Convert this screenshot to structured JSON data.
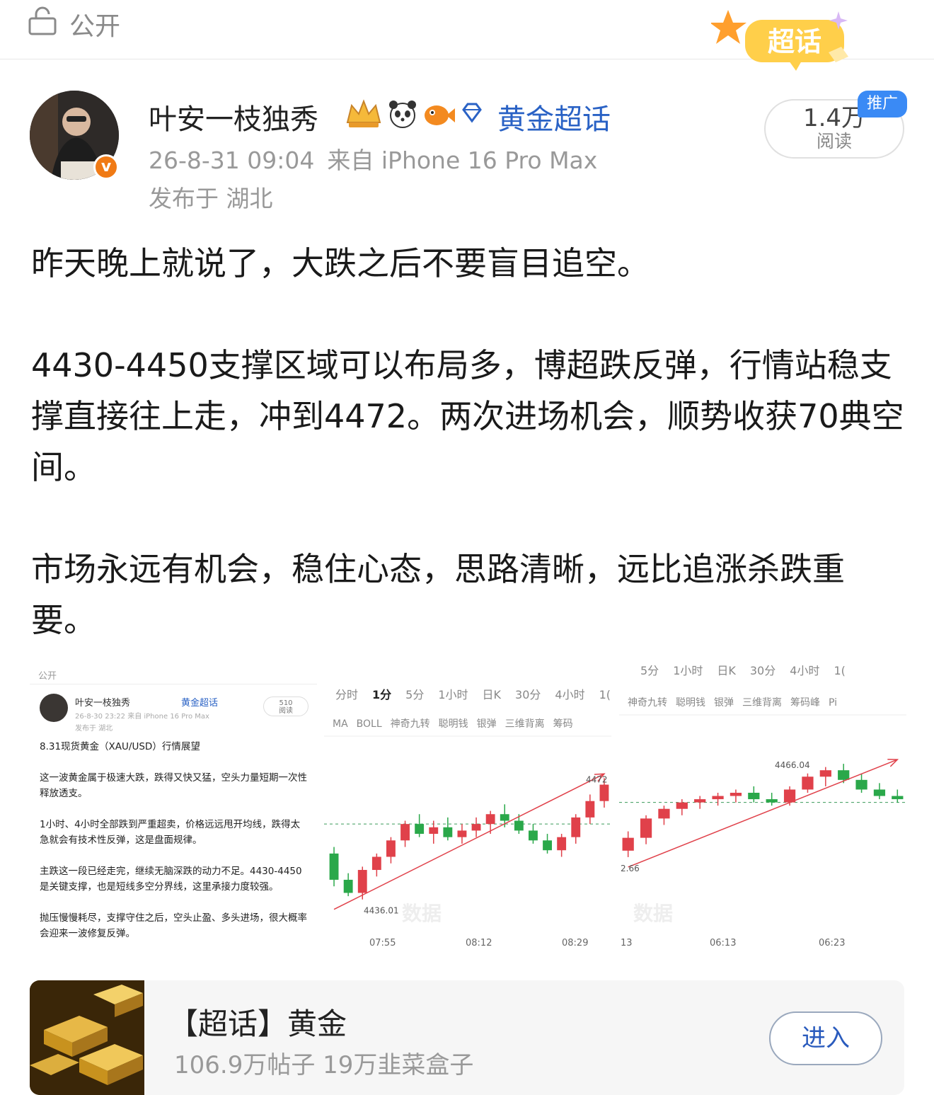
{
  "header": {
    "visibility_label": "公开",
    "supertopic_badge": "超话"
  },
  "author": {
    "name": "叶安一枝独秀",
    "topic_link": "黄金超话",
    "time": "26-8-31 09:04",
    "source": "来自 iPhone 16 Pro Max",
    "location": "发布于 湖北"
  },
  "read": {
    "count": "1.4万",
    "label": "阅读",
    "promo": "推广"
  },
  "post": {
    "p1": "昨天晚上就说了，大跌之后不要盲目追空。",
    "p2": "4430-4450支撑区域可以布局多，博超跌反弹，行情站稳支撑直接往上走，冲到4472。两次进场机会，顺势收获70典空间。",
    "p3": "市场永远有机会，稳住心态，思路清晰，远比追涨杀跌重要。"
  },
  "image1": {
    "visibility": "公开",
    "name": "叶安一枝独秀",
    "topic": "黄金超话",
    "meta": "26-8-30 23:22  来自 iPhone 16 Pro Max",
    "location": "发布于 湖北",
    "read_count": "510",
    "read_label": "阅读",
    "title": "8.31现货黄金（XAU/USD）行情展望",
    "para1": "这一波黄金属于极速大跌，跌得又快又猛，空头力量短期一次性释放透支。",
    "para2": "1小时、4小时全部跌到严重超卖，价格远远甩开均线，跌得太急就会有技术性反弹，这是盘面规律。",
    "para3": "主跌这一段已经走完，继续无脑深跌的动力不足。4430-4450是关键支撑，也是短线多空分界线，这里承接力度较强。",
    "para4": "抛压慢慢耗尽，支撑守住之后，空头止盈、多头进场，很大概率会迎来一波修复反弹。"
  },
  "chart1": {
    "tabs": [
      "分时",
      "1分",
      "5分",
      "1小时",
      "日K",
      "30分",
      "4小时",
      "1("
    ],
    "active_tab": "1分",
    "indicators": [
      "MA",
      "BOLL",
      "神奇九转",
      "聪明钱",
      "银弹",
      "三维背离",
      "筹码"
    ],
    "high_label": "4472",
    "low_label": "4436.01",
    "times": [
      "07:55",
      "08:12",
      "08:29"
    ]
  },
  "chart2": {
    "tabs_cut": [
      "5分",
      "1小时",
      "日K",
      "30分",
      "4小时",
      "1("
    ],
    "indicators": [
      "神奇九转",
      "聪明钱",
      "银弹",
      "三维背离",
      "筹码峰",
      "Pi"
    ],
    "high_label": "4466.04",
    "low_label": "2.66",
    "times": [
      "13",
      "06:13",
      "06:23"
    ]
  },
  "topic_card": {
    "title": "【超话】黄金",
    "stats": "106.9万帖子 19万韭菜盒子",
    "enter": "进入"
  },
  "colors": {
    "link": "#2a62c5",
    "up": "#e0414a",
    "down": "#2aa84a",
    "badge_orange": "#f07a15",
    "promo_blue": "#3a8af5"
  },
  "chart_data": [
    {
      "type": "candlestick",
      "title": "",
      "annotations": [
        "4472",
        "4436.01"
      ],
      "x_ticks": [
        "07:55",
        "08:12",
        "08:29"
      ],
      "ohlc": [
        [
          4450,
          4452,
          4440,
          4442
        ],
        [
          4442,
          4444,
          4437,
          4438
        ],
        [
          4438,
          4446,
          4436,
          4445
        ],
        [
          4445,
          4450,
          4443,
          4449
        ],
        [
          4449,
          4455,
          4447,
          4454
        ],
        [
          4454,
          4460,
          4452,
          4459
        ],
        [
          4459,
          4462,
          4455,
          4456
        ],
        [
          4456,
          4460,
          4453,
          4458
        ],
        [
          4458,
          4461,
          4454,
          4455
        ],
        [
          4455,
          4459,
          4453,
          4457
        ],
        [
          4457,
          4461,
          4455,
          4459
        ],
        [
          4459,
          4463,
          4456,
          4462
        ],
        [
          4462,
          4465,
          4458,
          4460
        ],
        [
          4460,
          4462,
          4456,
          4457
        ],
        [
          4457,
          4459,
          4453,
          4454
        ],
        [
          4454,
          4456,
          4450,
          4451
        ],
        [
          4451,
          4456,
          4449,
          4455
        ],
        [
          4455,
          4462,
          4453,
          4461
        ],
        [
          4461,
          4468,
          4459,
          4466
        ],
        [
          4466,
          4473,
          4464,
          4471
        ]
      ]
    },
    {
      "type": "candlestick",
      "title": "",
      "annotations": [
        "4466.04",
        "2.66"
      ],
      "x_ticks": [
        "13",
        "06:13",
        "06:23"
      ],
      "ohlc": [
        [
          4440,
          4446,
          4438,
          4444
        ],
        [
          4444,
          4451,
          4442,
          4450
        ],
        [
          4450,
          4454,
          4448,
          4453
        ],
        [
          4453,
          4456,
          4451,
          4455
        ],
        [
          4455,
          4457,
          4453,
          4456
        ],
        [
          4456,
          4458,
          4454,
          4457
        ],
        [
          4457,
          4459,
          4455,
          4458
        ],
        [
          4458,
          4460,
          4455,
          4456
        ],
        [
          4456,
          4458,
          4454,
          4455
        ],
        [
          4455,
          4460,
          4454,
          4459
        ],
        [
          4459,
          4464,
          4458,
          4463
        ],
        [
          4463,
          4466,
          4460,
          4465
        ],
        [
          4465,
          4467,
          4461,
          4462
        ],
        [
          4462,
          4464,
          4458,
          4459
        ],
        [
          4459,
          4461,
          4456,
          4457
        ],
        [
          4457,
          4459,
          4455,
          4456
        ]
      ]
    }
  ]
}
